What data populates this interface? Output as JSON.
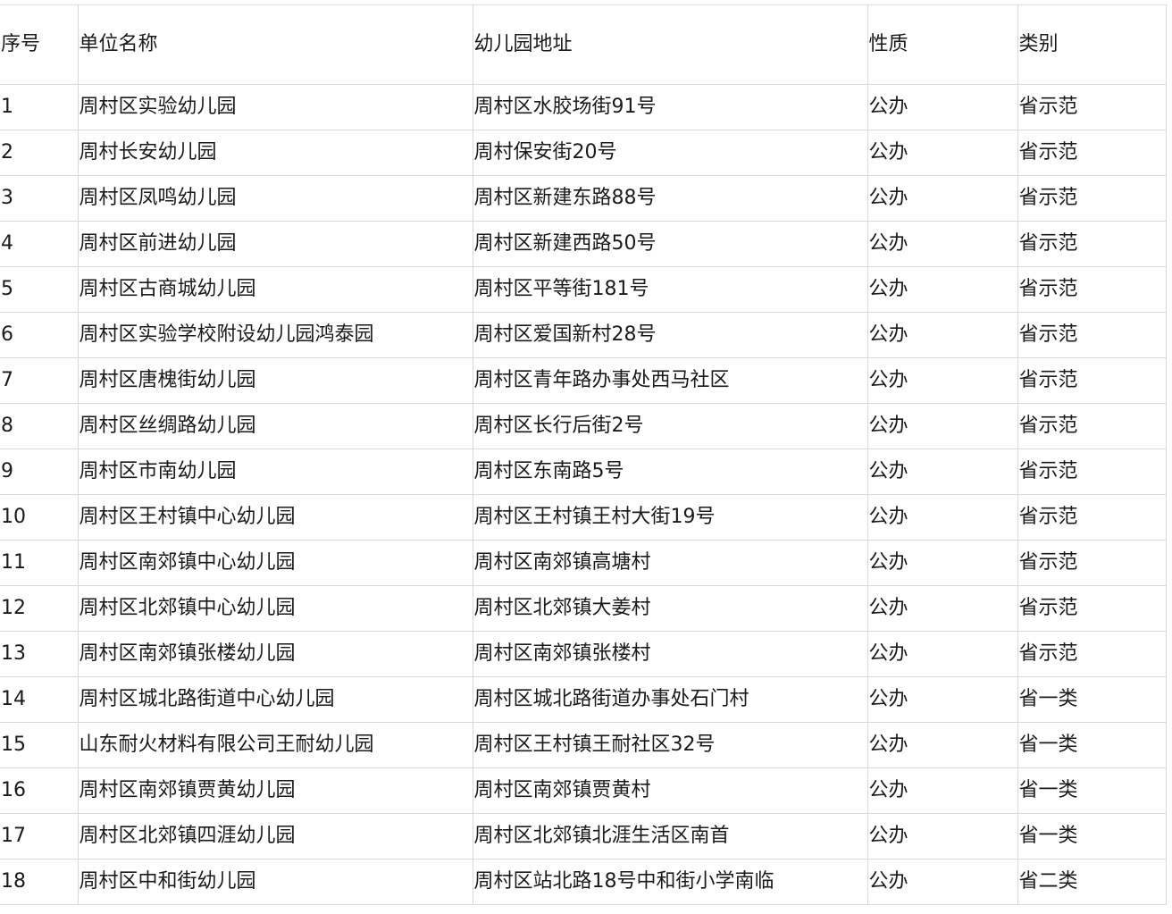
{
  "table": {
    "headers": [
      "序号",
      "单位名称",
      "幼儿园地址",
      "性质",
      "类别"
    ],
    "rows": [
      [
        "1",
        "周村区实验幼儿园",
        "周村区水胶场街91号",
        "公办",
        "省示范"
      ],
      [
        "2",
        "周村长安幼儿园",
        "周村保安街20号",
        "公办",
        "省示范"
      ],
      [
        "3",
        "周村区凤鸣幼儿园",
        "周村区新建东路88号",
        "公办",
        "省示范"
      ],
      [
        "4",
        "周村区前进幼儿园",
        "周村区新建西路50号",
        "公办",
        "省示范"
      ],
      [
        "5",
        "周村区古商城幼儿园",
        "周村区平等街181号",
        "公办",
        "省示范"
      ],
      [
        "6",
        "周村区实验学校附设幼儿园鸿泰园",
        "周村区爱国新村28号",
        "公办",
        "省示范"
      ],
      [
        "7",
        "周村区唐槐街幼儿园",
        "周村区青年路办事处西马社区",
        "公办",
        "省示范"
      ],
      [
        "8",
        "周村区丝绸路幼儿园",
        "周村区长行后街2号",
        "公办",
        "省示范"
      ],
      [
        "9",
        "周村区市南幼儿园",
        "周村区东南路5号",
        "公办",
        "省示范"
      ],
      [
        "10",
        "周村区王村镇中心幼儿园",
        "周村区王村镇王村大街19号",
        "公办",
        "省示范"
      ],
      [
        "11",
        "周村区南郊镇中心幼儿园",
        "周村区南郊镇高塘村",
        "公办",
        "省示范"
      ],
      [
        "12",
        "周村区北郊镇中心幼儿园",
        "周村区北郊镇大姜村",
        "公办",
        "省示范"
      ],
      [
        "13",
        "周村区南郊镇张楼幼儿园",
        "周村区南郊镇张楼村",
        "公办",
        "省示范"
      ],
      [
        "14",
        "周村区城北路街道中心幼儿园",
        "周村区城北路街道办事处石门村",
        "公办",
        "省一类"
      ],
      [
        "15",
        "山东耐火材料有限公司王耐幼儿园",
        "周村区王村镇王耐社区32号",
        "公办",
        "省一类"
      ],
      [
        "16",
        "周村区南郊镇贾黄幼儿园",
        "周村区南郊镇贾黄村",
        "公办",
        "省一类"
      ],
      [
        "17",
        "周村区北郊镇四涯幼儿园",
        "周村区北郊镇北涯生活区南首",
        "公办",
        "省一类"
      ],
      [
        "18",
        "周村区中和街幼儿园",
        "周村区站北路18号中和街小学南临",
        "公办",
        "省二类"
      ]
    ]
  }
}
